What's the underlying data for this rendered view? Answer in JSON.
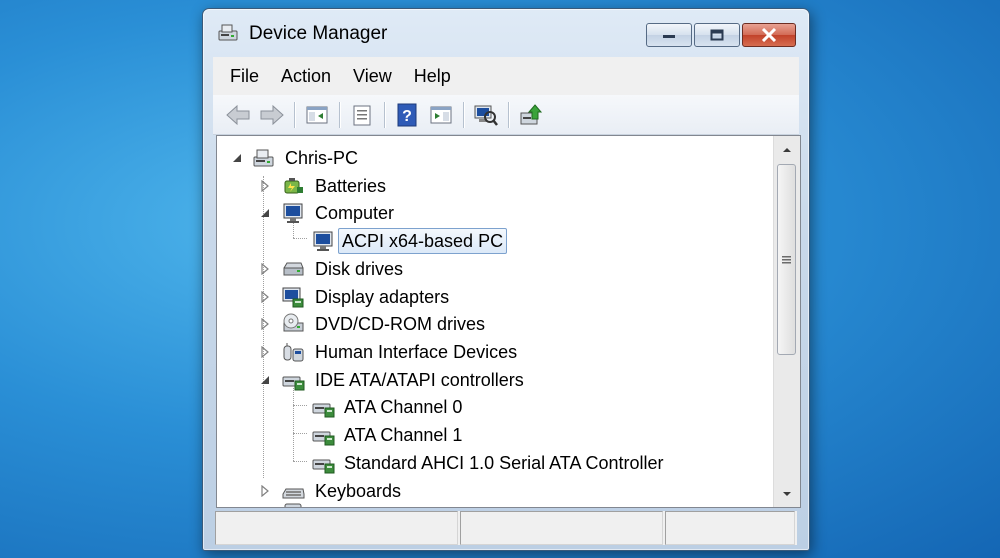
{
  "window": {
    "title": "Device Manager"
  },
  "menubar": {
    "items": [
      "File",
      "Action",
      "View",
      "Help"
    ]
  },
  "toolbar": {
    "buttons": [
      "back-icon",
      "forward-icon",
      "console-tree-icon",
      "properties-icon",
      "help-icon",
      "action-pane-icon",
      "scan-hardware-icon",
      "update-driver-icon"
    ]
  },
  "tree": {
    "nodes": [
      {
        "label": "Chris-PC",
        "icon": "computer-root-icon",
        "expanded": true
      },
      {
        "label": "Batteries",
        "icon": "battery-icon",
        "expanded": false
      },
      {
        "label": "Computer",
        "icon": "monitor-icon",
        "expanded": true
      },
      {
        "label": "ACPI x64-based PC",
        "icon": "monitor-icon",
        "selected": true
      },
      {
        "label": "Disk drives",
        "icon": "disk-drive-icon",
        "expanded": false
      },
      {
        "label": "Display adapters",
        "icon": "display-adapter-icon",
        "expanded": false
      },
      {
        "label": "DVD/CD-ROM drives",
        "icon": "dvd-drive-icon",
        "expanded": false
      },
      {
        "label": "Human Interface Devices",
        "icon": "hid-icon",
        "expanded": false
      },
      {
        "label": "IDE ATA/ATAPI controllers",
        "icon": "ide-controller-icon",
        "expanded": true
      },
      {
        "label": "ATA Channel 0",
        "icon": "ide-controller-icon"
      },
      {
        "label": "ATA Channel 1",
        "icon": "ide-controller-icon"
      },
      {
        "label": "Standard AHCI 1.0 Serial ATA Controller",
        "icon": "ide-controller-icon"
      },
      {
        "label": "Keyboards",
        "icon": "keyboard-icon",
        "expanded": false
      }
    ]
  },
  "colors": {
    "desktop": "#2a8fd6",
    "selection_border": "#7da2ce"
  }
}
